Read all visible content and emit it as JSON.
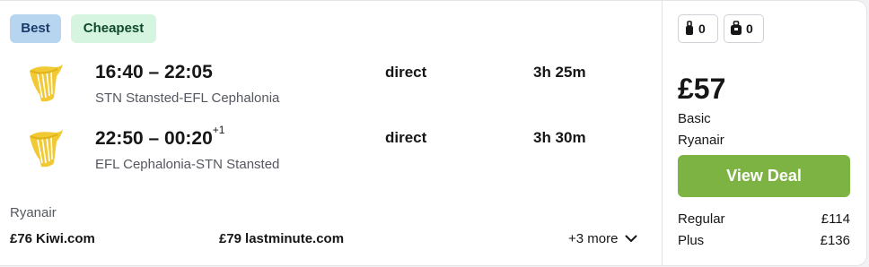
{
  "badges": {
    "best": "Best",
    "cheapest": "Cheapest"
  },
  "legs": [
    {
      "times": "16:40 – 22:05",
      "day_offset": "",
      "route": "STN Stansted-EFL Cephalonia",
      "stops": "direct",
      "duration": "3h 25m"
    },
    {
      "times": "22:50 – 00:20",
      "day_offset": "+1",
      "route": "EFL Cephalonia-STN Stansted",
      "stops": "direct",
      "duration": "3h 30m"
    }
  ],
  "footer": {
    "airline": "Ryanair",
    "alternatives": [
      {
        "price": "£76",
        "site": "Kiwi.com"
      },
      {
        "price": "£79",
        "site": "lastminute.com"
      }
    ],
    "more": "+3 more"
  },
  "bags": {
    "personal": "0",
    "carry_on": "0"
  },
  "deal": {
    "price": "£57",
    "fare": "Basic",
    "seller": "Ryanair",
    "button": "View Deal",
    "fares": [
      {
        "name": "Regular",
        "price": "£114"
      },
      {
        "name": "Plus",
        "price": "£136"
      }
    ]
  },
  "colors": {
    "button": "#7db343",
    "logo": "#f1c933",
    "best_badge": "#b7d5ef",
    "cheapest_badge": "#d6f5e1"
  }
}
